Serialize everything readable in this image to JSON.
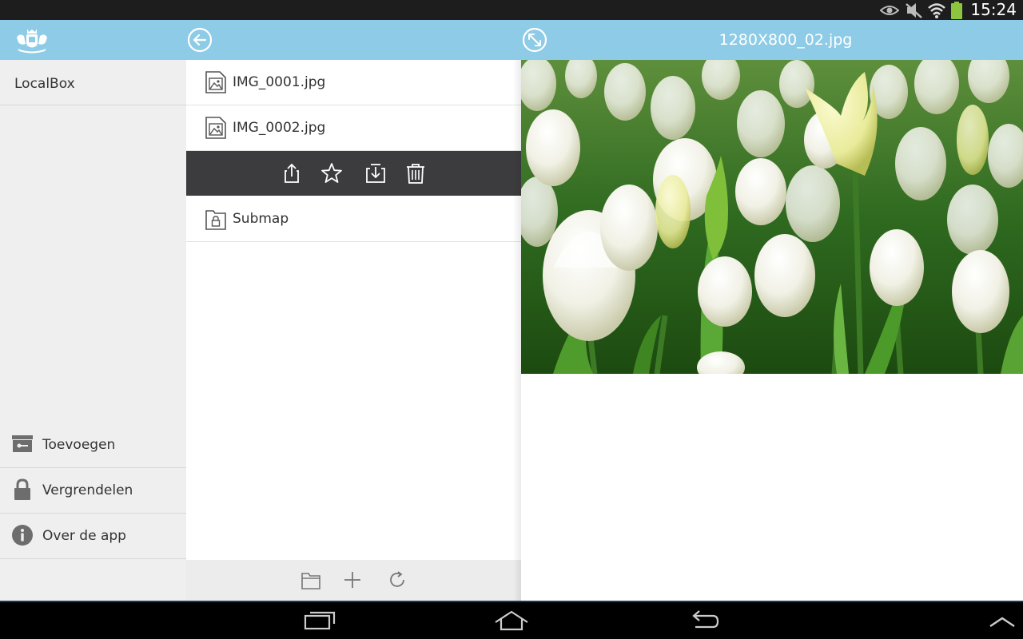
{
  "status_bar": {
    "time": "15:24",
    "icons": [
      "eye-icon",
      "mute-icon",
      "wifi-icon",
      "battery-icon"
    ],
    "battery_color": "#8cc63f"
  },
  "action_bar": {
    "background": "#8ecbe6",
    "logo": "coat-of-arms-logo",
    "back_icon": "arrow-left-circle-icon",
    "collapse_icon": "collapse-diagonal-icon",
    "preview_title": "1280X800_02.jpg"
  },
  "drawer": {
    "title": "LocalBox",
    "menu": [
      {
        "icon": "archive-key-icon",
        "label": "Toevoegen"
      },
      {
        "icon": "lock-icon",
        "label": "Vergrendelen"
      },
      {
        "icon": "info-icon",
        "label": "Over de app"
      }
    ]
  },
  "file_list": {
    "items": [
      {
        "icon": "image-file-icon",
        "name": "IMG_0001.jpg"
      },
      {
        "icon": "image-file-icon",
        "name": "IMG_0002.jpg",
        "selected": true
      },
      {
        "icon": "locked-folder-icon",
        "name": "Submap"
      }
    ],
    "selected_actions": [
      "share-icon",
      "star-icon",
      "move-icon",
      "trash-icon"
    ],
    "bottom_toolbar": [
      "new-folder-icon",
      "add-icon",
      "refresh-icon"
    ]
  },
  "preview": {
    "image": "white-tulips-photo"
  },
  "nav_bar": {
    "buttons": [
      "recent-apps-icon",
      "home-icon",
      "back-icon",
      "chevron-up-icon"
    ]
  }
}
